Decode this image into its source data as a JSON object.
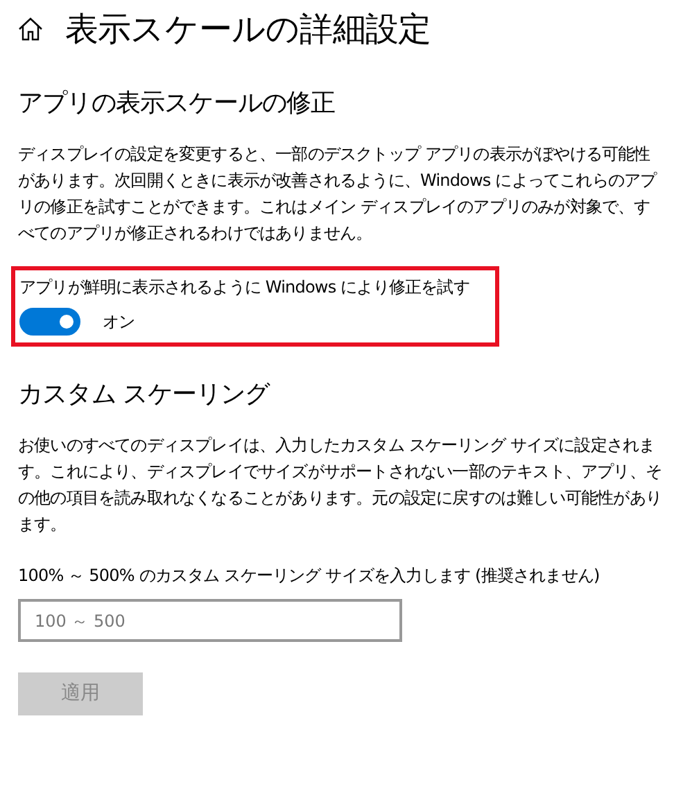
{
  "header": {
    "title": "表示スケールの詳細設定"
  },
  "fix_section": {
    "heading": "アプリの表示スケールの修正",
    "description": "ディスプレイの設定を変更すると、一部のデスクトップ アプリの表示がぼやける可能性があります。次回開くときに表示が改善されるように、Windows によってこれらのアプリの修正を試すことができます。これはメイン ディスプレイのアプリのみが対象で、すべてのアプリが修正されるわけではありません。",
    "toggle": {
      "label": "アプリが鮮明に表示されるように Windows により修正を試す",
      "on": true,
      "state_text": "オン",
      "highlighted": true
    }
  },
  "custom_section": {
    "heading": "カスタム スケーリング",
    "description": "お使いのすべてのディスプレイは、入力したカスタム スケーリング サイズに設定されます。これにより、ディスプレイでサイズがサポートされない一部のテキスト、アプリ、その他の項目を読み取れなくなることがあります。元の設定に戻すのは難しい可能性があります。",
    "input_label": "100% ～ 500% のカスタム スケーリング サイズを入力します (推奨されません)",
    "input": {
      "placeholder": "100 ～ 500"
    },
    "apply_button": {
      "label": "適用",
      "disabled": true
    }
  }
}
